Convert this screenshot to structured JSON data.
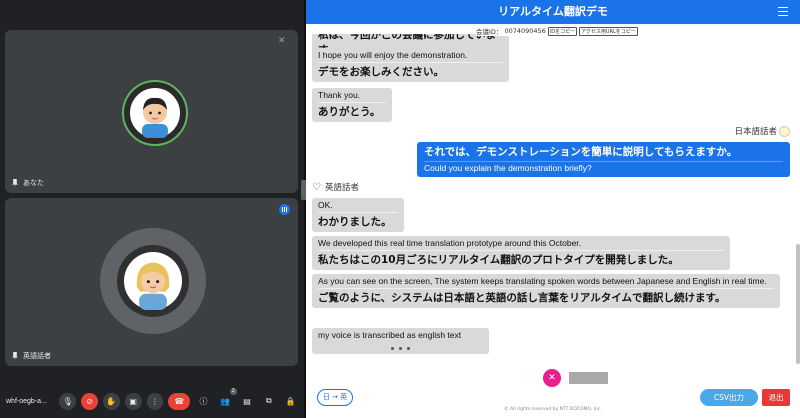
{
  "meet": {
    "tile1": {
      "name": "あなた"
    },
    "tile2": {
      "name": "英語話者"
    },
    "meeting_code": "whf-oegb-a...",
    "participants_count": "2"
  },
  "app": {
    "title": "リアルタイム翻訳デモ",
    "meeting_id_label": "会議ID：",
    "meeting_id": "0074090456",
    "copy_id_button": "IDをコピー",
    "copy_url_button": "アクセス用URLをコピー",
    "messages": [
      {
        "ja": "私は、今回がこの会議に参加しています。"
      },
      {
        "en": "I hope you will enjoy the demonstration.",
        "ja": "デモをお楽しみください。"
      },
      {
        "en": "Thank you.",
        "ja": "ありがとう。"
      },
      {
        "speaker": "日本語話者"
      },
      {
        "ja": "それでは、デモンストレーションを簡単に説明してもらえますか。",
        "en": "Could you explain the demonstration briefly?"
      },
      {
        "speaker": "英語話者"
      },
      {
        "en": "OK.",
        "ja": "わかりました。"
      },
      {
        "en": "We developed this real time translation prototype around this October.",
        "ja": "私たちはこの10月ごろにリアルタイム翻訳のプロトタイプを開発しました。"
      },
      {
        "en": "As you can see on the screen, The system keeps translating spoken words between Japanese and English in real time.",
        "ja": "ご覧のように、システムは日本語と英語の話し言葉をリアルタイムで翻訳し続けます。"
      },
      {
        "en": "my voice is transcribed as english text"
      }
    ],
    "lang_button": "日 → 英",
    "csv_button": "CSV出力",
    "exit_button": "退出",
    "copyright": "© All rights reserved by NTT DOCOMO, Inc.",
    "colors": {
      "header": "#1a73e8",
      "my_bubble": "#1a73e8",
      "other_bubble": "#d9d9d9",
      "mic_off": "#e91e8c",
      "exit": "#e53935",
      "csv": "#4aa8e8"
    }
  }
}
